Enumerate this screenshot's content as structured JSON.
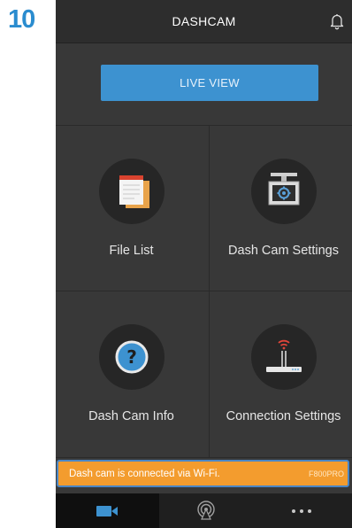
{
  "step_number": "10",
  "header": {
    "title": "DASHCAM",
    "icon": "bell-icon"
  },
  "live_view": {
    "label": "LIVE VIEW"
  },
  "tiles": [
    {
      "label": "File List",
      "icon": "file-list-icon"
    },
    {
      "label": "Dash Cam Settings",
      "icon": "dashcam-settings-icon"
    },
    {
      "label": "Dash Cam Info",
      "icon": "info-question-icon"
    },
    {
      "label": "Connection Settings",
      "icon": "wifi-router-icon"
    }
  ],
  "status": {
    "message": "Dash cam is connected via Wi-Fi.",
    "model": "F800PRO"
  },
  "bottom_nav": [
    {
      "icon": "video-camera-icon",
      "active": true
    },
    {
      "icon": "broadcast-icon",
      "active": false
    },
    {
      "icon": "more-dots-icon",
      "active": false
    }
  ],
  "colors": {
    "accent_blue": "#3d92d0",
    "status_orange": "#f39c2e",
    "step_blue": "#2a8ccf",
    "background_dark": "#383838"
  }
}
